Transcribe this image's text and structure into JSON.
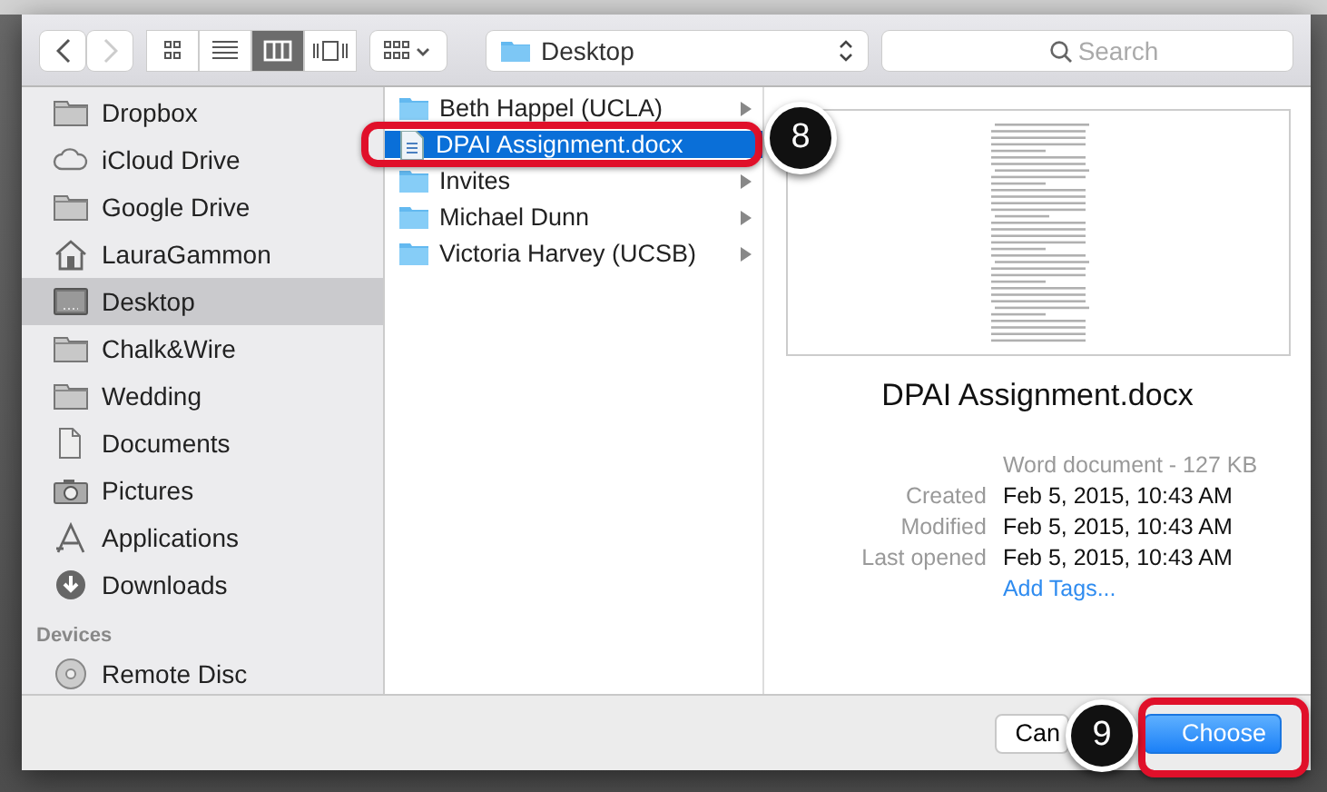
{
  "toolbar": {
    "nav": [
      {
        "kind": "back",
        "disabled": false
      },
      {
        "kind": "forward",
        "disabled": true
      }
    ],
    "views": [
      {
        "kind": "icons",
        "selected": false
      },
      {
        "kind": "list",
        "selected": false
      },
      {
        "kind": "columns",
        "selected": true
      },
      {
        "kind": "coverflow",
        "selected": false
      }
    ],
    "location": "Desktop",
    "search": {
      "placeholder": "Search"
    }
  },
  "sidebar": {
    "items": [
      {
        "label": "Dropbox",
        "kind": "folder",
        "selected": false
      },
      {
        "label": "iCloud Drive",
        "kind": "cloud",
        "selected": false
      },
      {
        "label": "Google Drive",
        "kind": "folder",
        "selected": false
      },
      {
        "label": "LauraGammon",
        "kind": "home",
        "selected": false
      },
      {
        "label": "Desktop",
        "kind": "desktop",
        "selected": true
      },
      {
        "label": "Chalk&Wire",
        "kind": "folder",
        "selected": false
      },
      {
        "label": "Wedding",
        "kind": "folder",
        "selected": false
      },
      {
        "label": "Documents",
        "kind": "document",
        "selected": false
      },
      {
        "label": "Pictures",
        "kind": "camera",
        "selected": false
      },
      {
        "label": "Applications",
        "kind": "apps",
        "selected": false
      },
      {
        "label": "Downloads",
        "kind": "download",
        "selected": false
      }
    ],
    "section": "Devices",
    "devices": [
      {
        "label": "Remote Disc",
        "kind": "disc",
        "selected": false
      }
    ]
  },
  "files": [
    {
      "name": "Beth Happel (UCLA)",
      "kind": "folder",
      "selected": false
    },
    {
      "name": "DPAI Assignment.docx",
      "kind": "document",
      "selected": true
    },
    {
      "name": "Invites",
      "kind": "folder",
      "selected": false
    },
    {
      "name": "Michael Dunn",
      "kind": "folder",
      "selected": false
    },
    {
      "name": "Victoria Harvey (UCSB)",
      "kind": "folder",
      "selected": false
    }
  ],
  "preview": {
    "name": "DPAI Assignment.docx",
    "info": "Word document - 127 KB",
    "fields": [
      {
        "label": "Created",
        "value": "Feb 5, 2015, 10:43 AM"
      },
      {
        "label": "Modified",
        "value": "Feb 5, 2015, 10:43 AM"
      },
      {
        "label": "Last opened",
        "value": "Feb 5, 2015, 10:43 AM"
      }
    ],
    "add_tags": "Add Tags..."
  },
  "buttons": {
    "cancel": "Can",
    "choose": "Choose"
  },
  "annotations": [
    "8",
    "9"
  ]
}
